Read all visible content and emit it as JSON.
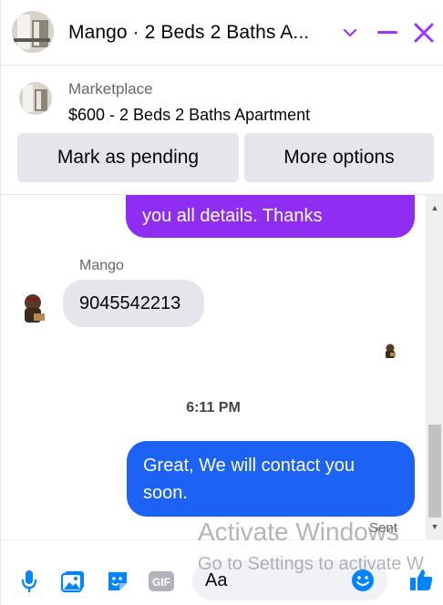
{
  "header": {
    "title": "Mango · 2 Beds 2 Baths A...",
    "colors": {
      "accent": "#a033ff"
    }
  },
  "marketplace": {
    "label": "Marketplace",
    "listing": "$600 - 2 Beds 2 Baths Apartment",
    "buttons": {
      "pending": "Mark as pending",
      "more": "More options"
    }
  },
  "messages": {
    "outgoing_top": "you all details. Thanks",
    "incoming_sender": "Mango",
    "incoming_text": "9045542213",
    "timestamp": "6:11 PM",
    "outgoing_bottom_line1": "Great, We will contact you",
    "outgoing_bottom_line2": "soon.",
    "status": "Sent"
  },
  "composer": {
    "placeholder": "Aa",
    "icons": [
      "microphone-icon",
      "photo-icon",
      "sticker-icon",
      "gif-icon",
      "emoji-icon",
      "thumbs-up-icon"
    ]
  },
  "watermark": {
    "line1": "Activate Windows",
    "line2": "Go to Settings to activate W"
  },
  "colors": {
    "gradient_top": "#9b23f5",
    "bubble_bottom": "#1a64f5",
    "icon_blue": "#0084ff"
  }
}
